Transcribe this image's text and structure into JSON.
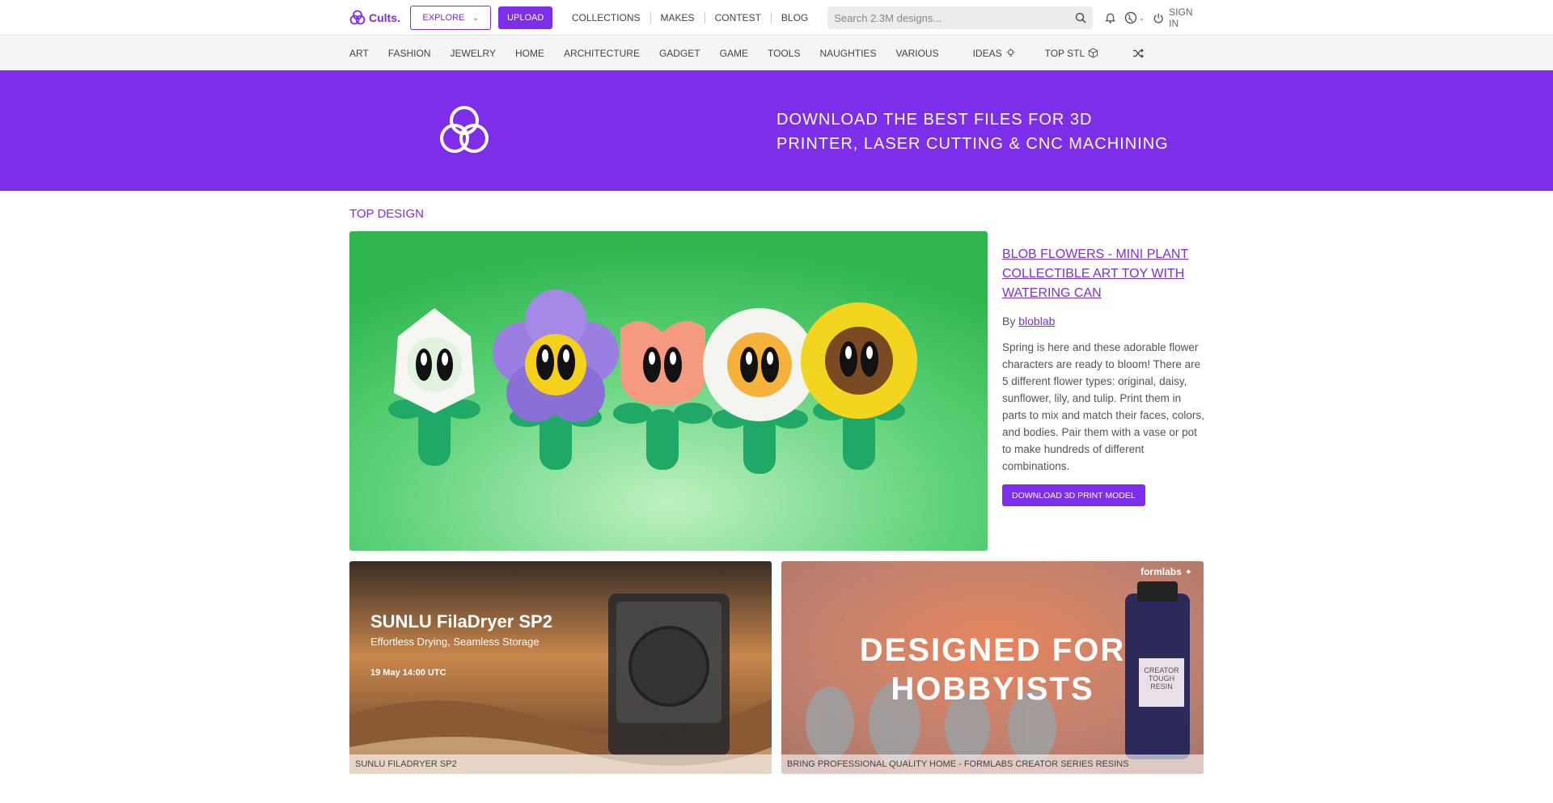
{
  "header": {
    "logo_text": "Cults.",
    "explore_label": "EXPLORE",
    "upload_label": "UPLOAD",
    "nav": [
      "COLLECTIONS",
      "MAKES",
      "CONTEST",
      "BLOG"
    ],
    "search_placeholder": "Search 2.3M designs...",
    "sign_in": "SIGN IN"
  },
  "categories": [
    "ART",
    "FASHION",
    "JEWELRY",
    "HOME",
    "ARCHITECTURE",
    "GADGET",
    "GAME",
    "TOOLS",
    "NAUGHTIES",
    "VARIOUS"
  ],
  "extra_nav": {
    "ideas": "IDEAS",
    "top_stl": "TOP STL"
  },
  "hero": {
    "line1": "DOWNLOAD THE BEST FILES FOR 3D",
    "line2": "PRINTER, LASER CUTTING & CNC MACHINING"
  },
  "top_design": {
    "section_title": "TOP DESIGN",
    "title": "BLOB FLOWERS - MINI PLANT COLLECTIBLE ART TOY WITH WATERING CAN",
    "by_prefix": "By",
    "author": "bloblab",
    "description": "Spring is here and these adorable flower characters are ready to bloom! There are 5 different flower types: original, daisy, sunflower, lily, and tulip. Print them in parts to mix and match their faces, colors, and bodies. Pair them with a vase or pot to make hundreds of different combinations.",
    "button": "DOWNLOAD 3D PRINT MODEL"
  },
  "banners": [
    {
      "headline": "SUNLU FilaDryer SP2",
      "sub": "Effortless Drying, Seamless Storage",
      "date": "19 May 14:00 UTC",
      "caption": "SUNLU FILADRYER SP2"
    },
    {
      "brand": "formlabs",
      "headline1": "DESIGNED FOR",
      "headline2": "HOBBYISTS",
      "bottle_label": "CREATOR TOUGH RESIN",
      "caption": "BRING PROFESSIONAL QUALITY HOME - FORMLABS CREATOR SERIES RESINS"
    }
  ],
  "colors": {
    "accent": "#7c2ee8"
  }
}
